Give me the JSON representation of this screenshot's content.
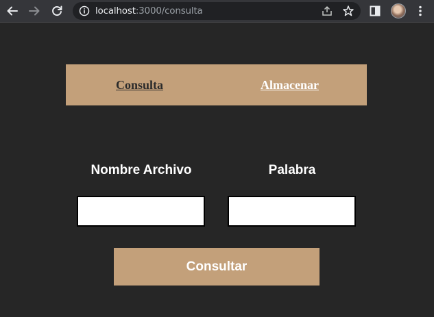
{
  "browser": {
    "url_host": "localhost",
    "url_path": ":3000/consulta"
  },
  "nav": {
    "consulta": "Consulta",
    "almacenar": "Almacenar"
  },
  "form": {
    "nombre_label": "Nombre Archivo",
    "nombre_value": "",
    "palabra_label": "Palabra",
    "palabra_value": "",
    "submit_label": "Consultar"
  },
  "colors": {
    "page_background": "#262626",
    "accent": "#c3a07a",
    "chrome": "#35363a"
  }
}
